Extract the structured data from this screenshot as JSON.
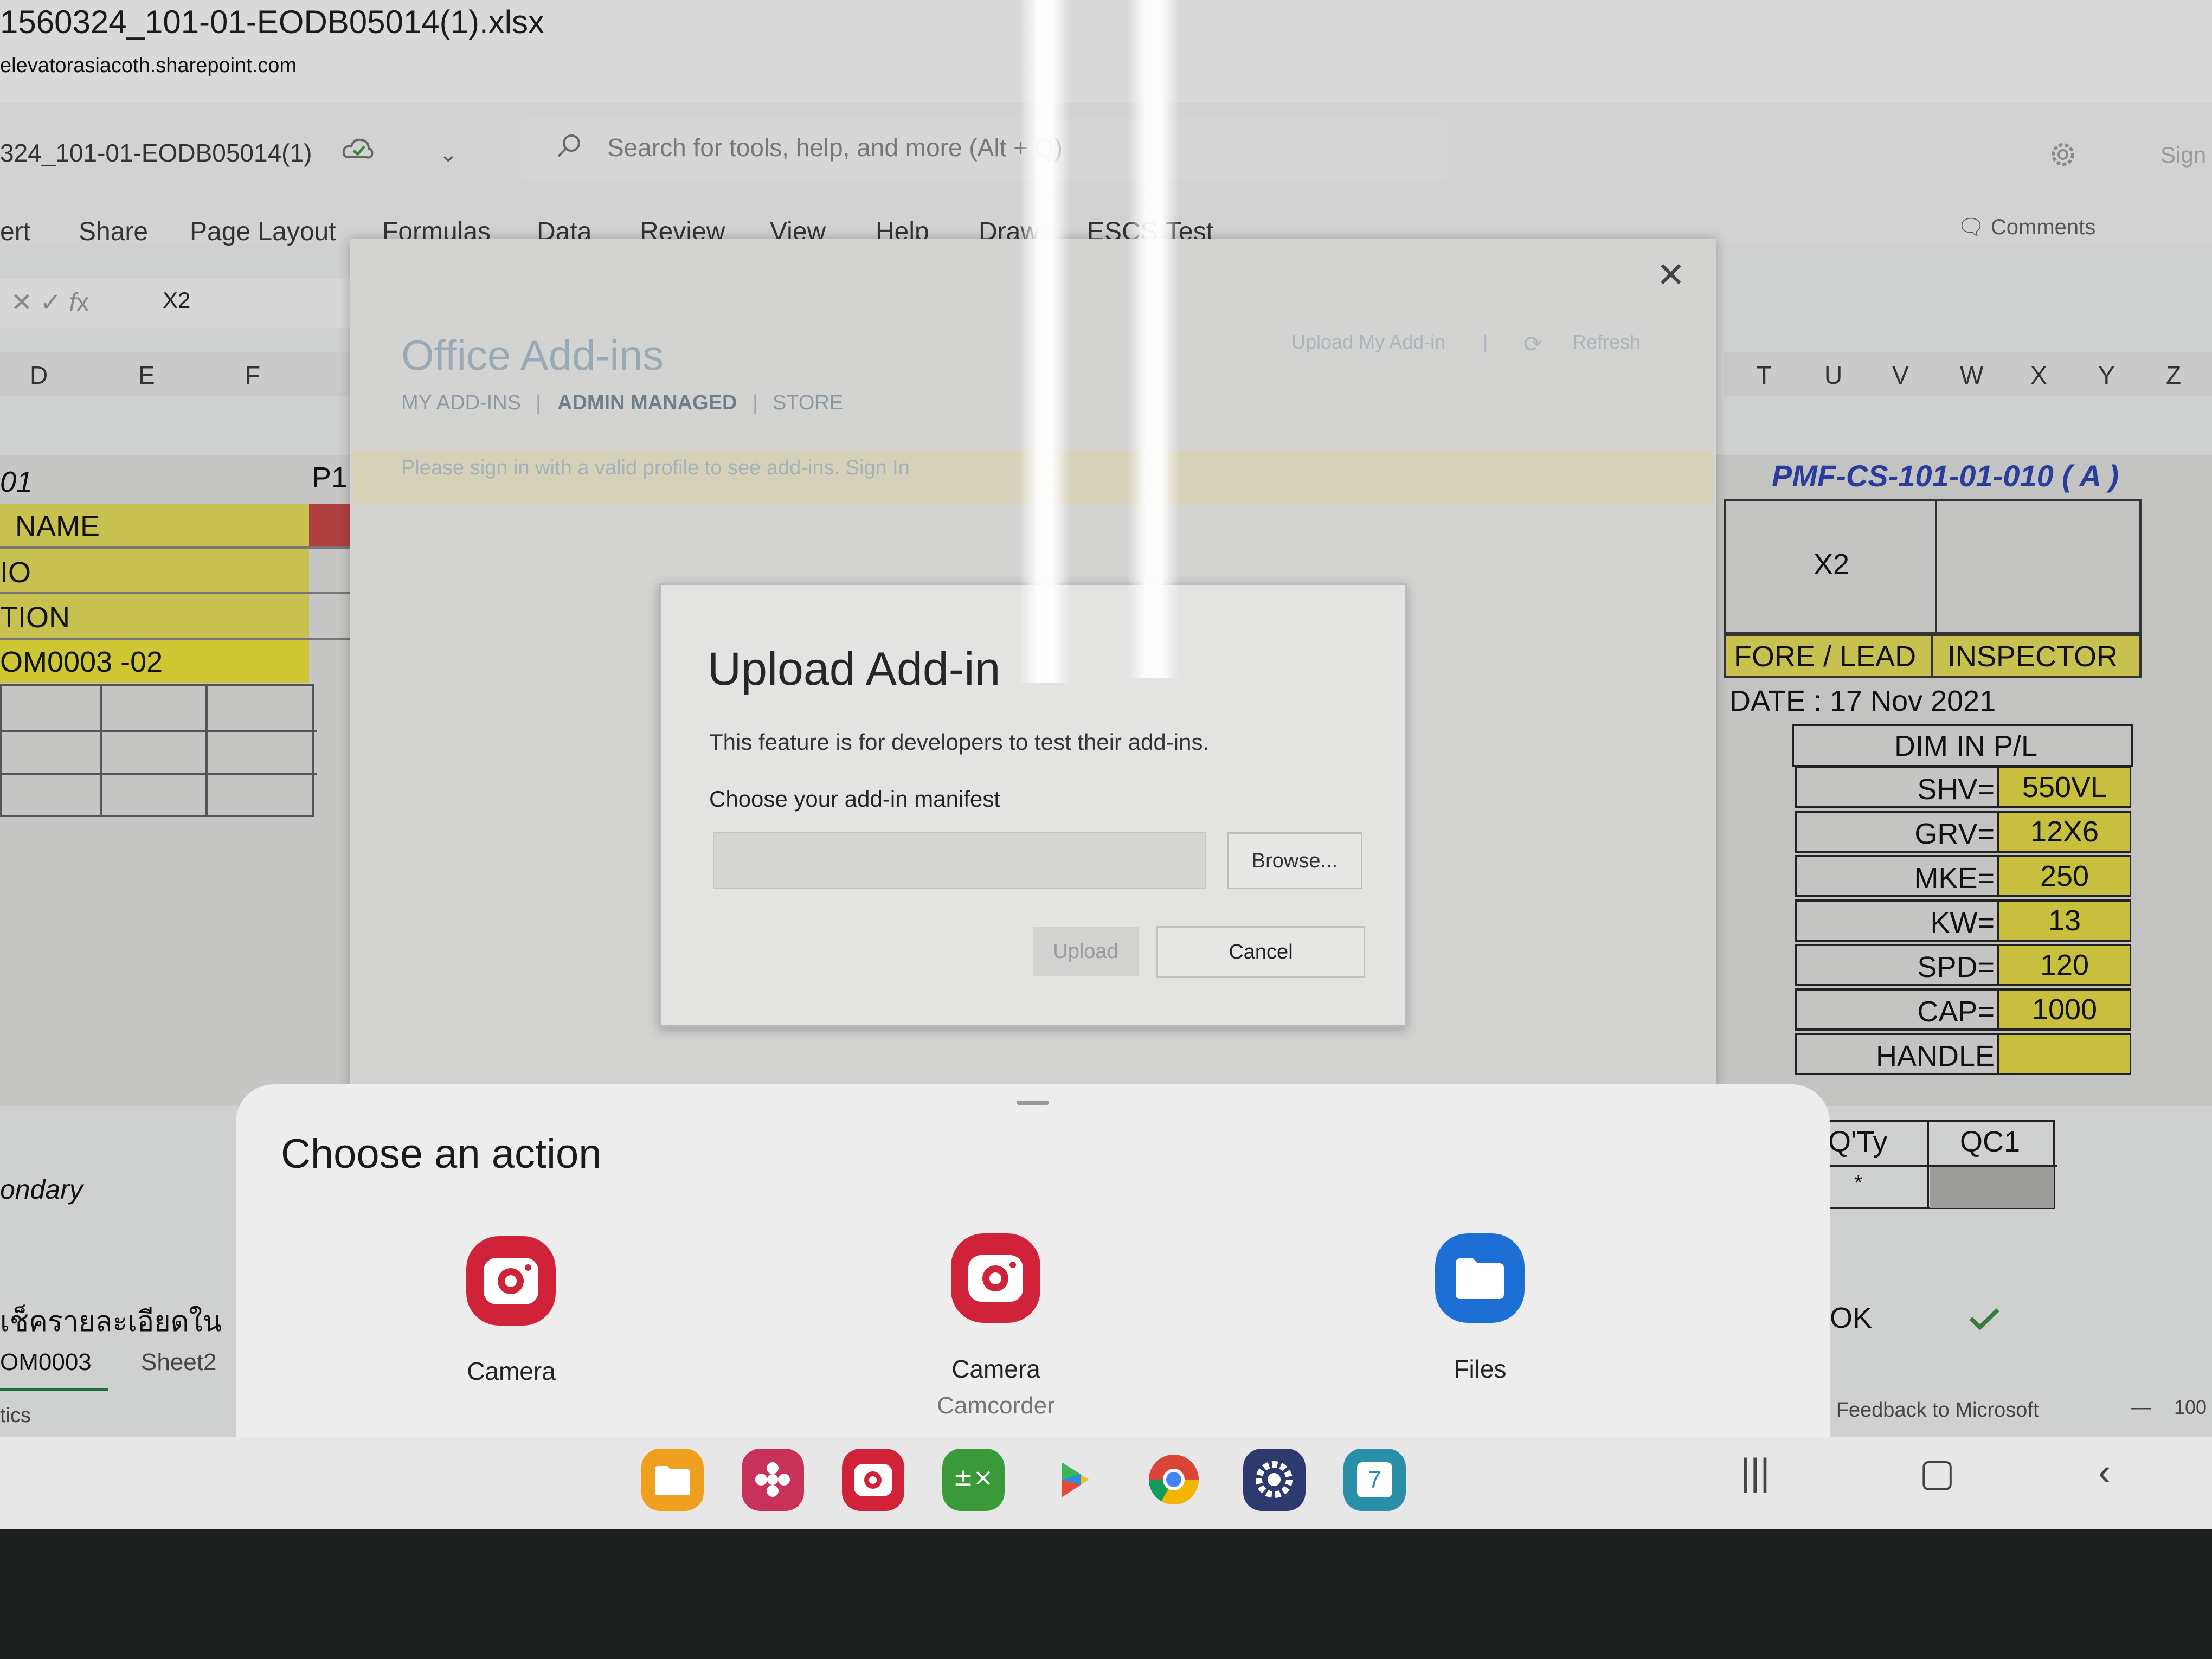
{
  "browser": {
    "document_title": "1560324_101-01-EODB05014(1).xlsx",
    "url": "elevatorasiacoth.sharepoint.com"
  },
  "excel": {
    "file_name": "324_101-01-EODB05014(1)",
    "search_placeholder": "Search for tools, help, and more (Alt + Q)",
    "sign_in": "Sign",
    "ribbon_tabs": [
      "ert",
      "Share",
      "Page Layout",
      "Formulas",
      "Data",
      "Review",
      "View",
      "Help",
      "Draw",
      "ESCS",
      "Test"
    ],
    "comments_label": "Comments",
    "name_box": "X2",
    "left_columns": [
      "D",
      "E",
      "F"
    ],
    "right_columns": [
      "T",
      "U",
      "V",
      "W",
      "X",
      "Y",
      "Z"
    ],
    "left_cells": {
      "row_01": "01",
      "p1": "P1",
      "name": "NAME",
      "io": "IO",
      "tion": "TION",
      "code": "OM0003 -02",
      "secondary": "ondary",
      "thai_text": "เช็ครายละเอียดใน"
    },
    "sheet_tabs": [
      "OM0003",
      "Sheet2"
    ],
    "status_left": "tics",
    "right_cells": {
      "doc_code": "PMF-CS-101-01-010 ( A )",
      "x2": "X2",
      "fore_lead": "FORE / LEAD",
      "inspector": "INSPECTOR",
      "date": "DATE : 17 Nov 2021",
      "dim_header": "DIM IN P/L",
      "dims": [
        {
          "label": "SHV=",
          "value": "550VL"
        },
        {
          "label": "GRV=",
          "value": "12X6"
        },
        {
          "label": "MKE=",
          "value": "250"
        },
        {
          "label": "KW=",
          "value": "13"
        },
        {
          "label": "SPD=",
          "value": "120"
        },
        {
          "label": "CAP=",
          "value": "1000"
        },
        {
          "label": "HANDLE",
          "value": ""
        }
      ],
      "qty": "Q'Ty",
      "qc1": "QC1",
      "star": "*",
      "ok": "OK"
    },
    "feedback": "e Feedback to Microsoft",
    "zoom": "100"
  },
  "addins_dialog": {
    "title": "Office Add-ins",
    "nav": [
      "MY ADD-INS",
      "ADMIN MANAGED",
      "STORE"
    ],
    "upload_my_addin": "Upload My Add-in",
    "refresh": "Refresh",
    "signin_message": "Please sign in with a valid profile to see add-ins. Sign In"
  },
  "upload_dialog": {
    "title": "Upload Add-in",
    "description": "This feature is for developers to test their add-ins.",
    "choose_label": "Choose your add-in manifest",
    "browse_label": "Browse...",
    "upload_label": "Upload",
    "cancel_label": "Cancel"
  },
  "action_sheet": {
    "title": "Choose an action",
    "apps": [
      {
        "label": "Camera",
        "sub": "",
        "icon": "camera-icon"
      },
      {
        "label": "Camera",
        "sub": "Camcorder",
        "icon": "camcorder-icon"
      },
      {
        "label": "Files",
        "sub": "",
        "icon": "folder-icon"
      }
    ]
  },
  "dock": {
    "apps": [
      "my-files-icon",
      "gallery-icon",
      "camera-icon",
      "calculator-icon",
      "play-store-icon",
      "chrome-icon",
      "settings-icon",
      "calendar-icon"
    ],
    "calendar_day": "7"
  },
  "colors": {
    "excel_yellow": "#c9c14f",
    "camera_red": "#d0233a",
    "files_blue": "#1d6fd6"
  }
}
